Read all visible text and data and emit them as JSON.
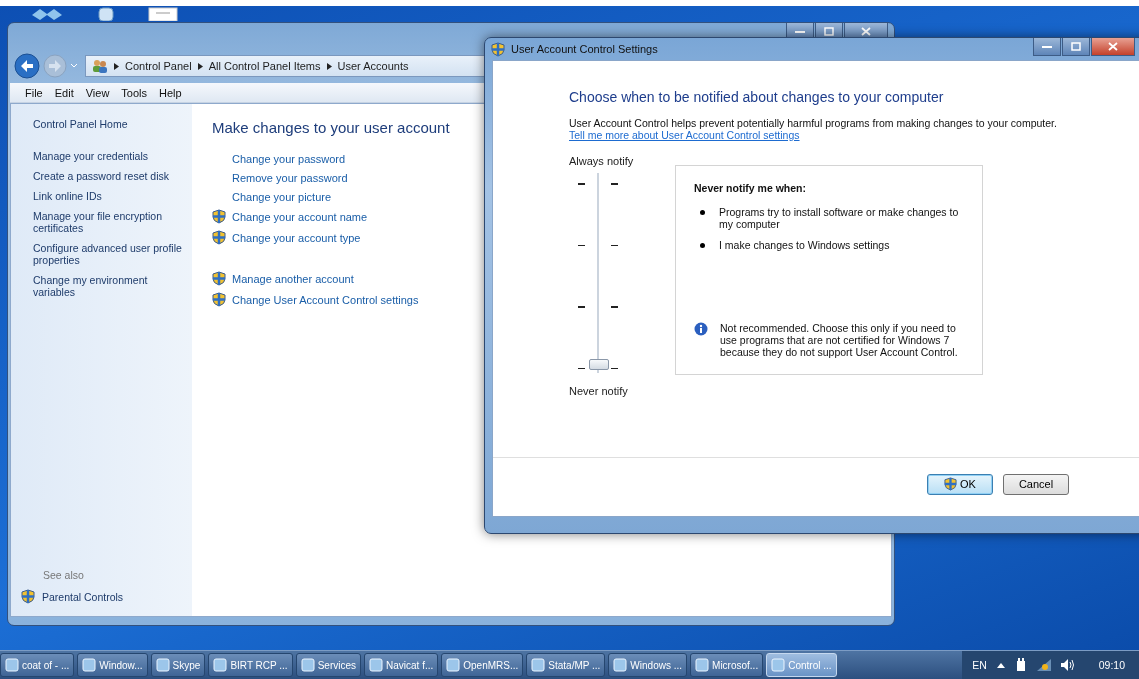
{
  "explorer": {
    "breadcrumbs": [
      "Control Panel",
      "All Control Panel Items",
      "User Accounts"
    ],
    "menu": [
      "File",
      "Edit",
      "View",
      "Tools",
      "Help"
    ],
    "sidebar": {
      "home": "Control Panel Home",
      "tasks": [
        "Manage your credentials",
        "Create a password reset disk",
        "Link online IDs",
        "Manage your file encryption certificates",
        "Configure advanced user profile properties",
        "Change my environment variables"
      ],
      "see_also": "See also",
      "see_also_links": [
        {
          "label": "Parental Controls",
          "shield": true
        }
      ]
    },
    "heading": "Make changes to your user account",
    "task_groups": [
      [
        {
          "label": "Change your password",
          "shield": false
        },
        {
          "label": "Remove your password",
          "shield": false
        },
        {
          "label": "Change your picture",
          "shield": false
        },
        {
          "label": "Change your account name",
          "shield": true
        },
        {
          "label": "Change your account type",
          "shield": true
        }
      ],
      [
        {
          "label": "Manage another account",
          "shield": true
        },
        {
          "label": "Change User Account Control settings",
          "shield": true
        }
      ]
    ]
  },
  "dialog": {
    "title": "User Account Control Settings",
    "heading": "Choose when to be notified about changes to your computer",
    "description": "User Account Control helps prevent potentially harmful programs from making changes to your computer.",
    "link": "Tell me more about User Account Control settings",
    "slider": {
      "top_label": "Always notify",
      "bottom_label": "Never notify",
      "level": 0
    },
    "panel": {
      "heading": "Never notify me when:",
      "bullets": [
        "Programs try to install software or make changes to my computer",
        "I make changes to Windows settings"
      ],
      "note": "Not recommended. Choose this only if you need to use programs that are not certified for Windows 7 because they do not support User Account Control."
    },
    "buttons": [
      {
        "label": "OK",
        "shield": true,
        "default": true
      },
      {
        "label": "Cancel",
        "shield": false,
        "default": false
      }
    ]
  },
  "taskbar": {
    "items": [
      {
        "label": "coat of  - ...",
        "selected": false
      },
      {
        "label": "Window...",
        "selected": false
      },
      {
        "label": "Skype",
        "selected": false
      },
      {
        "label": "BIRT RCP ...",
        "selected": false
      },
      {
        "label": "Services",
        "selected": false
      },
      {
        "label": "Navicat f...",
        "selected": false
      },
      {
        "label": "OpenMRS...",
        "selected": false
      },
      {
        "label": "Stata/MP ...",
        "selected": false
      },
      {
        "label": "Windows ...",
        "selected": false
      },
      {
        "label": "Microsof...",
        "selected": false
      },
      {
        "label": "Control ...",
        "selected": true
      }
    ],
    "language": "EN",
    "clock": "09:10"
  }
}
